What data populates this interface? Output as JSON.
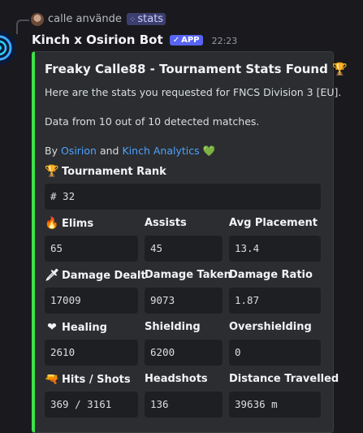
{
  "reply": {
    "user": "calle",
    "action": "använde",
    "command_icon": "⁘",
    "command": "stats"
  },
  "message": {
    "author": "Kinch x Osirion Bot",
    "badge": "APP",
    "badge_check": "✓",
    "time": "22:23"
  },
  "embed": {
    "accent_color": "#3ee04a",
    "title": "Freaky Calle88 - Tournament Stats Found",
    "title_emoji": "🏆",
    "desc_line1": "Here are the stats you requested for FNCS Division 3 [EU].",
    "desc_line2": "Data from 10 out of 10 detected matches.",
    "by": "By",
    "link1": "Osirion",
    "and": "and",
    "link2": "Kinch Analytics",
    "heart_emoji": "💚",
    "rank": {
      "emoji": "🏆",
      "label": "Tournament Rank",
      "value": "# 32"
    },
    "fields": [
      {
        "emoji": "🔥",
        "label": "Elims",
        "value": "65"
      },
      {
        "label": "Assists",
        "value": "45"
      },
      {
        "label": "Avg Placement",
        "value": "13.4"
      },
      {
        "emoji": "🗡",
        "label": "Damage Dealt",
        "value": "17009"
      },
      {
        "label": "Damage Taken",
        "value": "9073"
      },
      {
        "label": "Damage Ratio",
        "value": "1.87"
      },
      {
        "emoji": "❤",
        "label": "Healing",
        "value": "2610"
      },
      {
        "label": "Shielding",
        "value": "6200"
      },
      {
        "label": "Overshielding",
        "value": "0"
      },
      {
        "emoji": "🔫",
        "label": "Hits / Shots",
        "value": "369 / 3161"
      },
      {
        "label": "Headshots",
        "value": "136"
      },
      {
        "label": "Distance Travelled",
        "value": "39636 m"
      }
    ]
  }
}
